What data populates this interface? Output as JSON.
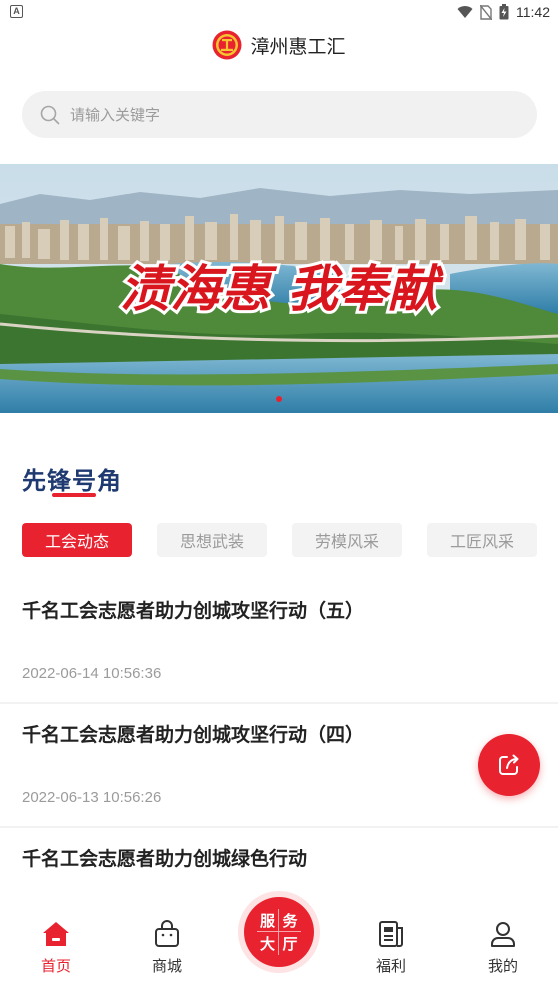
{
  "status_bar": {
    "time": "11:42",
    "left_icon": "A",
    "icons": [
      "wifi-icon",
      "no-sim-icon",
      "battery-charging-icon"
    ]
  },
  "header": {
    "title": "漳州惠工汇",
    "logo_icon": "union-logo-icon"
  },
  "search": {
    "placeholder": "请输入关键字",
    "icon": "search-icon"
  },
  "banner": {
    "slogan": "渍海惠 我奉献",
    "active_dot_index": 0,
    "dot_count": 1
  },
  "section": {
    "title": "先锋号角"
  },
  "tabs": [
    {
      "label": "工会动态",
      "active": true
    },
    {
      "label": "思想武装",
      "active": false
    },
    {
      "label": "劳模风采",
      "active": false
    },
    {
      "label": "工匠风采",
      "active": false
    }
  ],
  "articles": [
    {
      "title": "千名工会志愿者助力创城攻坚行动（五）",
      "date": "2022-06-14 10:56:36"
    },
    {
      "title": "千名工会志愿者助力创城攻坚行动（四）",
      "date": "2022-06-13 10:56:26"
    },
    {
      "title": "千名工会志愿者助力创城绿色行动",
      "date": ""
    }
  ],
  "fab": {
    "icon": "share-icon"
  },
  "bottom_nav": {
    "items": [
      {
        "label": "首页",
        "icon": "home-icon",
        "active": true
      },
      {
        "label": "商城",
        "icon": "shopping-bag-icon",
        "active": false
      },
      {
        "label": "福利",
        "icon": "document-icon",
        "active": false
      },
      {
        "label": "我的",
        "icon": "user-icon",
        "active": false
      }
    ],
    "center_button": {
      "chars": [
        "服",
        "务",
        "大",
        "厅"
      ]
    }
  },
  "colors": {
    "accent": "#e8222f",
    "section_title": "#1f3a70",
    "muted_text": "#9b9b9b",
    "tab_bg": "#f3f3f3"
  }
}
